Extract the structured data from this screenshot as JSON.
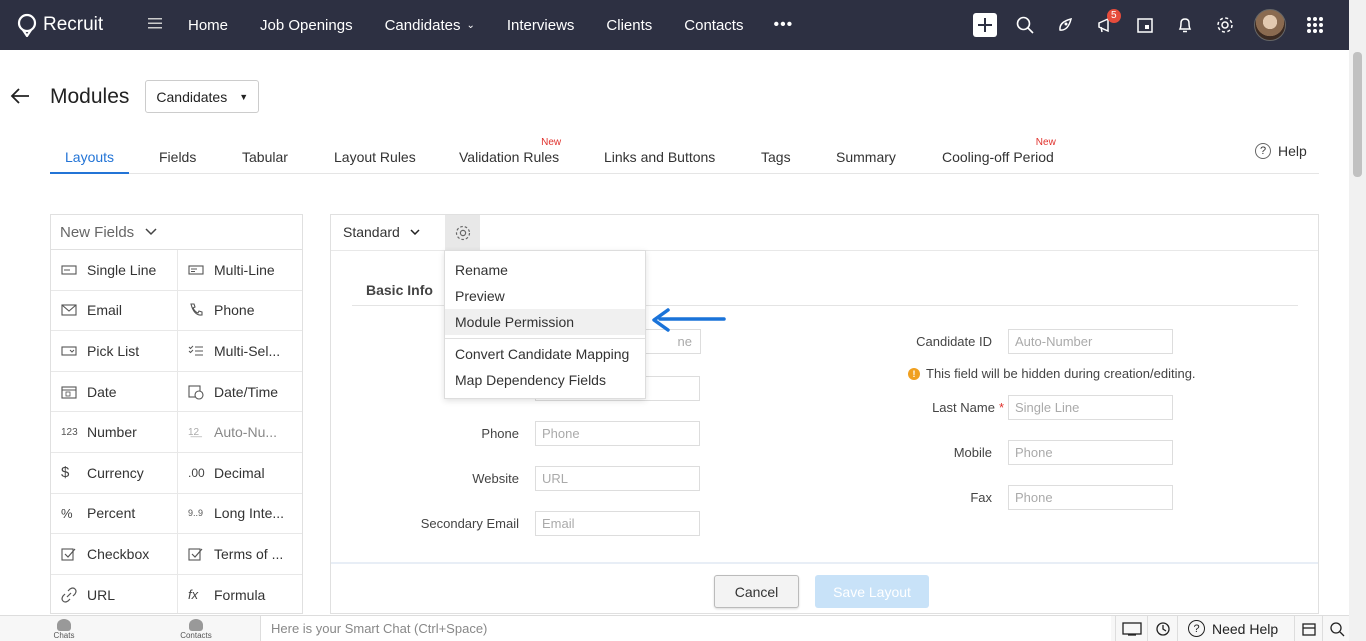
{
  "app": {
    "name": "Recruit"
  },
  "nav": {
    "items": [
      "Home",
      "Job Openings",
      "Candidates",
      "Interviews",
      "Clients",
      "Contacts"
    ],
    "more": "•••"
  },
  "topbar": {
    "notifications_count": "5"
  },
  "header": {
    "title": "Modules",
    "module_select": "Candidates"
  },
  "tabs": [
    {
      "label": "Layouts",
      "active": true,
      "new": ""
    },
    {
      "label": "Fields",
      "new": ""
    },
    {
      "label": "Tabular",
      "new": ""
    },
    {
      "label": "Layout Rules",
      "new": ""
    },
    {
      "label": "Validation Rules",
      "new": "New"
    },
    {
      "label": "Links and Buttons",
      "new": ""
    },
    {
      "label": "Tags",
      "new": ""
    },
    {
      "label": "Summary",
      "new": ""
    },
    {
      "label": "Cooling-off Period",
      "new": "New"
    }
  ],
  "help": {
    "label": "Help"
  },
  "palette": {
    "title": "New Fields",
    "fields": [
      {
        "label": "Single Line",
        "icon": "single-line-icon"
      },
      {
        "label": "Multi-Line",
        "icon": "multi-line-icon"
      },
      {
        "label": "Email",
        "icon": "envelope-icon"
      },
      {
        "label": "Phone",
        "icon": "phone-icon"
      },
      {
        "label": "Pick List",
        "icon": "picklist-icon"
      },
      {
        "label": "Multi-Sel...",
        "icon": "multi-select-icon"
      },
      {
        "label": "Date",
        "icon": "calendar-icon"
      },
      {
        "label": "Date/Time",
        "icon": "datetime-icon"
      },
      {
        "label": "Number",
        "icon": "number-icon"
      },
      {
        "label": "Auto-Nu...",
        "icon": "auto-number-icon"
      },
      {
        "label": "Currency",
        "icon": "dollar-icon"
      },
      {
        "label": "Decimal",
        "icon": "decimal-icon"
      },
      {
        "label": "Percent",
        "icon": "percent-icon"
      },
      {
        "label": "Long Inte...",
        "icon": "long-integer-icon"
      },
      {
        "label": "Checkbox",
        "icon": "checkbox-icon"
      },
      {
        "label": "Terms of ...",
        "icon": "terms-icon"
      },
      {
        "label": "URL",
        "icon": "link-icon"
      },
      {
        "label": "Formula",
        "icon": "formula-icon"
      }
    ]
  },
  "layout": {
    "layout_select": "Standard",
    "section_title": "Basic Info",
    "left_fields": [
      {
        "label": "Phone",
        "placeholder": "Phone"
      },
      {
        "label": "Website",
        "placeholder": "URL"
      },
      {
        "label": "Secondary Email",
        "placeholder": "Email"
      }
    ],
    "hidden_placeholders": [
      "ne",
      ""
    ],
    "right_fields": [
      {
        "label": "Candidate ID",
        "placeholder": "Auto-Number"
      },
      {
        "label": "Last Name",
        "placeholder": "Single Line",
        "required": "*"
      },
      {
        "label": "Mobile",
        "placeholder": "Phone"
      },
      {
        "label": "Fax",
        "placeholder": "Phone"
      }
    ],
    "hint": "This field will be hidden during creation/editing.",
    "cancel": "Cancel",
    "save": "Save Layout"
  },
  "menu": {
    "items": [
      "Rename",
      "Preview",
      "Module Permission",
      "Convert Candidate Mapping",
      "Map Dependency Fields"
    ],
    "highlighted": "Module Permission"
  },
  "bottombar": {
    "chats": "Chats",
    "contacts": "Contacts",
    "smart_chat": "Here is your Smart Chat (Ctrl+Space)",
    "need_help": "Need Help"
  },
  "colors": {
    "topbar": "#2d3042",
    "accent": "#2374d6",
    "new_badge": "#e0312c",
    "arrow": "#1a73d9"
  }
}
